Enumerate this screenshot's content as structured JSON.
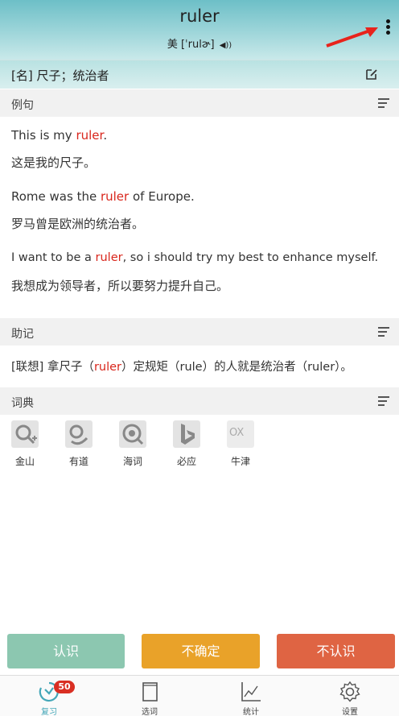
{
  "header": {
    "word": "ruler",
    "phonetic_prefix": "美",
    "phonetic": "[ˈrulɚ]",
    "speaker_icon": "speaker-icon",
    "more_icon": "more-vertical-icon"
  },
  "definition": {
    "text": "[名] 尺子；统治者",
    "edit_icon": "edit-icon"
  },
  "sections": {
    "examples": "例句",
    "mnemonic": "助记",
    "dictionary": "词典"
  },
  "examples": [
    {
      "en_before": "This is my ",
      "highlight": "ruler",
      "en_after": ".",
      "zh": "这是我的尺子。"
    },
    {
      "en_before": "Rome was the ",
      "highlight": "ruler",
      "en_after": " of Europe.",
      "zh": "罗马曾是欧洲的统治者。"
    },
    {
      "en_before": "I want to be a ",
      "highlight": "ruler",
      "en_after": ", so i should try my best to enhance myself.",
      "zh": "我想成为领导者，所以要努力提升自己。"
    }
  ],
  "mnemonic": {
    "before": "[联想] 拿尺子（",
    "hl1": "ruler",
    "middle": "）定规矩（rule）的人就是统治者（ruler）。"
  },
  "dictionaries": [
    {
      "label": "金山",
      "icon": "jinshan-icon"
    },
    {
      "label": "有道",
      "icon": "youdao-icon"
    },
    {
      "label": "海词",
      "icon": "haici-icon"
    },
    {
      "label": "必应",
      "icon": "bing-icon"
    },
    {
      "label": "牛津",
      "icon": "oxford-icon",
      "logo_text": "OX"
    }
  ],
  "actions": {
    "know": "认识",
    "unsure": "不确定",
    "dont_know": "不认识"
  },
  "tabs": [
    {
      "label": "复习",
      "badge": "50",
      "active": true
    },
    {
      "label": "选词"
    },
    {
      "label": "统计"
    },
    {
      "label": "设置"
    }
  ],
  "colors": {
    "highlight": "#d9261c",
    "know": "#8cc7b0",
    "unsure": "#e9a229",
    "dont_know": "#df6443",
    "accent": "#44a7b8"
  }
}
